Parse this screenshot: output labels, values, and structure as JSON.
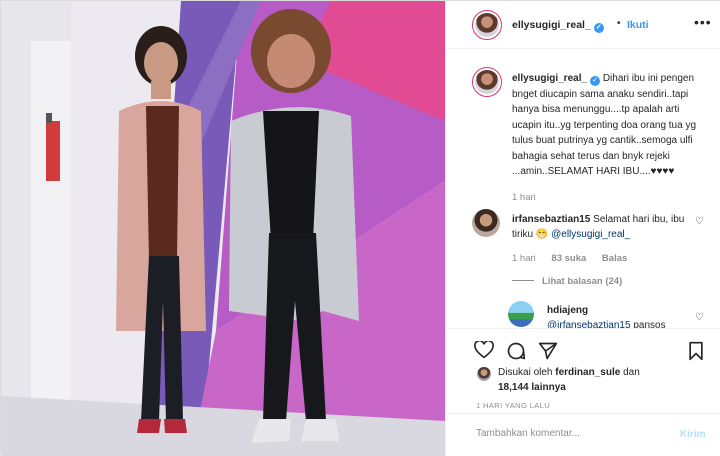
{
  "header": {
    "username": "ellysugigi_real_",
    "verified_icon": "verified-badge-icon",
    "separator": "•",
    "follow_label": "Ikuti",
    "more_icon": "more-options-icon"
  },
  "caption": {
    "username": "ellysugigi_real_",
    "text": "Dihari ibu ini pengen bnget diucapin sama anaku sendiri..tapi hanya bisa menunggu....tp apalah arti ucapin itu..yg terpenting doa orang tua yg tulus buat putrinya yg cantik..semoga ulfi bahagia sehat terus dan bnyk rejeki ...amin..SELAMAT HARI IBU....♥♥♥♥",
    "time": "1 hari"
  },
  "comment": {
    "username": "irfansebaztian15",
    "text": "Selamat hari ibu, ibu tiriku 😁 ",
    "mention": "@ellysugigi_real_",
    "time": "1 hari",
    "likes": "83 suka",
    "reply_label": "Balas",
    "view_replies": "Lihat balasan (24)"
  },
  "reply": {
    "username": "hdiajeng",
    "mention": "@irfansebaztian15",
    "text": " pansos"
  },
  "actions": {
    "like_icon": "heart-icon",
    "comment_icon": "comment-icon",
    "share_icon": "share-icon",
    "save_icon": "bookmark-icon"
  },
  "likes": {
    "prefix": "Disukai oleh ",
    "user": "ferdinan_sule",
    "middle": " dan ",
    "count": "18,144 lainnya"
  },
  "date": "1 HARI YANG LALU",
  "add_comment": {
    "placeholder": "Tambahkan komentar...",
    "post_label": "Kirim"
  },
  "colors": {
    "accent": "#3897f0",
    "post_disabled": "#b2dffc",
    "wall_purple": "#b75cc6",
    "wall_pink": "#e14b93"
  }
}
